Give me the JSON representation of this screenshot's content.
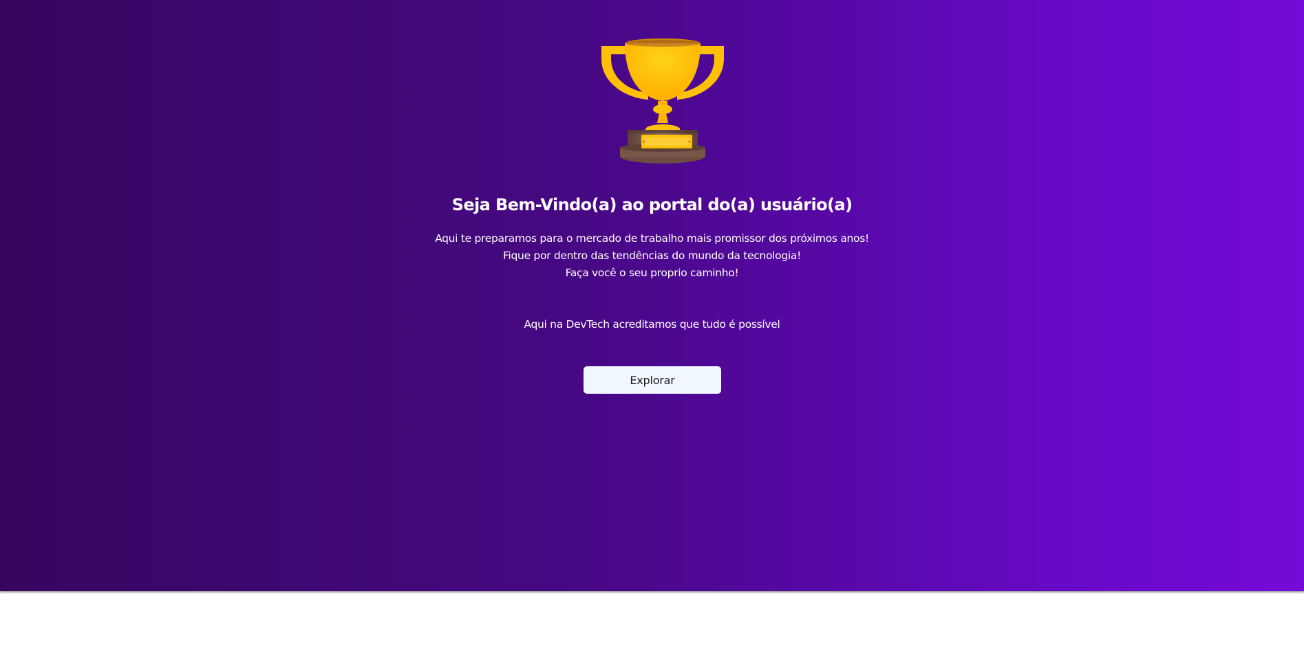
{
  "hero": {
    "icon": "trophy-icon",
    "title": "Seja Bem-Vindo(a) ao portal do(a) usuário(a)",
    "lines": [
      "Aqui te preparamos para o mercado de trabalho mais promissor dos próximos anos!",
      "Fique por dentro das tendências do mundo da tecnologia!",
      "Faça você o seu proprio caminho!"
    ],
    "tagline": "Aqui na DevTech acreditamos que tudo é possível",
    "button_label": "Explorar"
  },
  "colors": {
    "gradient_start": "#36065f",
    "gradient_end": "#740bd8",
    "trophy_gold": "#ffc107",
    "trophy_base": "#6d4c41",
    "button_bg": "#f0f7ff",
    "text": "#ffffff"
  }
}
